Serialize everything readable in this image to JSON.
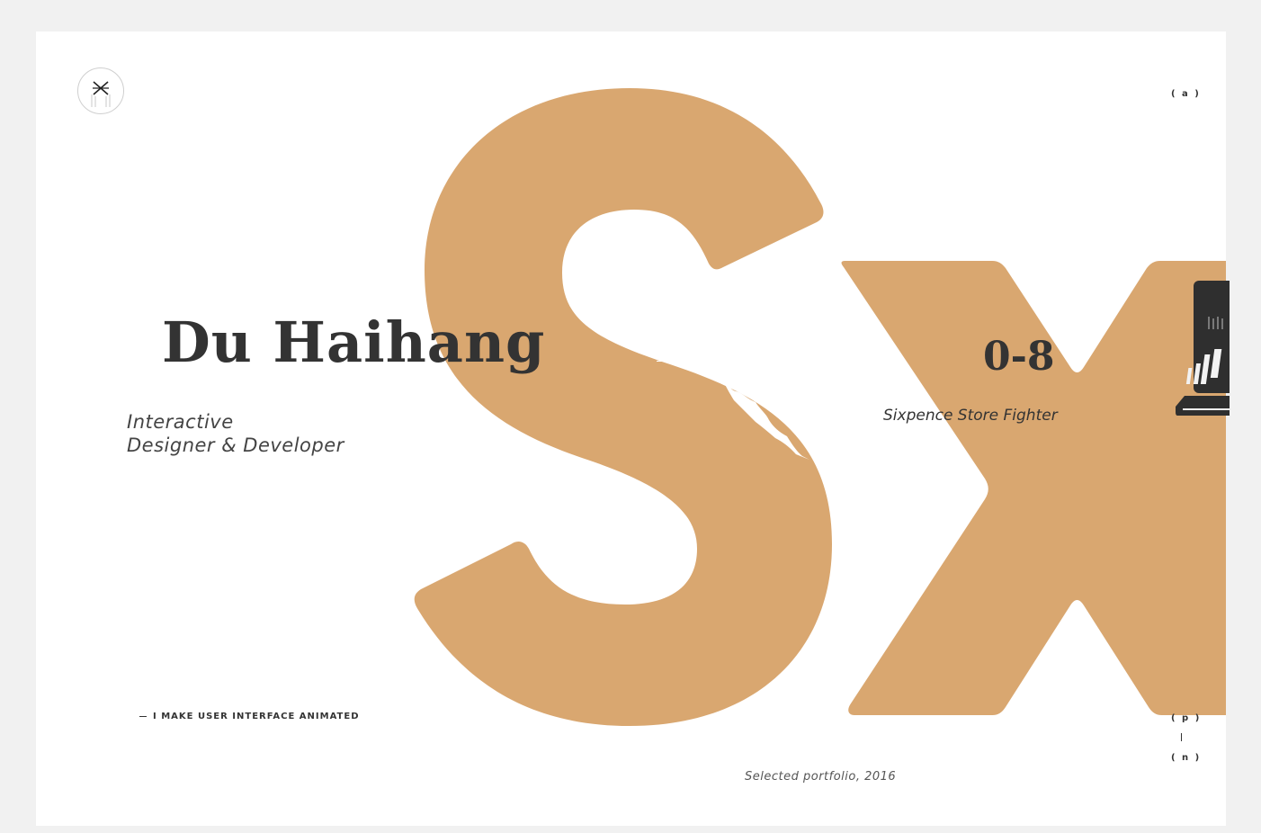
{
  "brand": {
    "logo_icon": "monogram-x-icon"
  },
  "hero": {
    "name": "Du Haihang",
    "role_line1": "Interactive",
    "role_line2": "Designer & Developer",
    "tagline": "I MAKE USER INTERFACE ANIMATED"
  },
  "project": {
    "letters": "Sx",
    "counter": "0-8",
    "title": "Sixpence Store Fighter",
    "accent_color": "#d9a770"
  },
  "nav": {
    "about": "( a )",
    "prev": "( p )",
    "next": "( n )"
  },
  "footer": {
    "caption": "Selected portfolio, 2016"
  }
}
